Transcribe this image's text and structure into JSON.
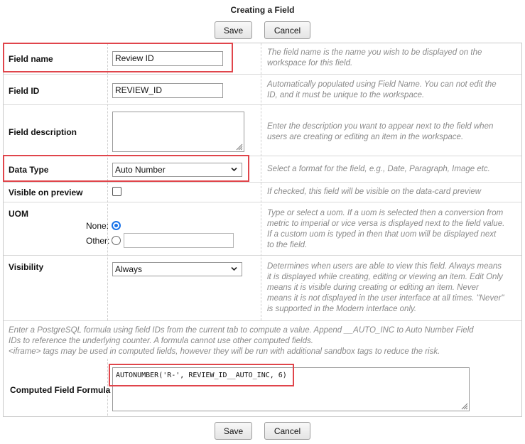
{
  "header": {
    "title": "Creating a Field"
  },
  "toolbar": {
    "save_label": "Save",
    "cancel_label": "Cancel"
  },
  "fields": {
    "field_name": {
      "label": "Field name",
      "value": "Review ID",
      "help": [
        "The field name is the name you wish to be displayed on the",
        "workspace for this field."
      ]
    },
    "field_id": {
      "label": "Field ID",
      "value": "REVIEW_ID",
      "help": [
        "Automatically populated using Field Name. You can not edit the",
        "ID, and it must be unique to the workspace."
      ]
    },
    "field_description": {
      "label": "Field description",
      "value": "",
      "help": [
        "Enter the description you want to appear next to the field when",
        "users are creating or editing an item in the workspace."
      ]
    },
    "data_type": {
      "label": "Data Type",
      "value": "Auto Number",
      "help": [
        "Select a format for the field, e.g., Date, Paragraph, Image etc."
      ]
    },
    "visible_on_preview": {
      "label": "Visible on preview",
      "checked": false,
      "help": [
        "If checked, this field will be visible on the data-card preview"
      ]
    },
    "uom": {
      "label": "UOM",
      "none_label": "None:",
      "other_label": "Other:",
      "selected": "None",
      "other_value": "",
      "help": [
        "Type or select a uom. If a uom is selected then a conversion from",
        "metric to imperial or vice versa is displayed next to the field value.",
        "If a custom uom is typed in then that uom will be displayed next",
        "to the field."
      ]
    },
    "visibility": {
      "label": "Visibility",
      "value": "Always",
      "help": [
        "Determines when users are able to view this field. Always means",
        "it is displayed while creating, editing or viewing an item. Edit Only",
        "means it is visible during creating or editing an item. Never",
        "means it is not displayed in the user interface at all times. \"Never\"",
        "is supported in the Modern interface only."
      ]
    },
    "computed": {
      "intro": [
        "Enter a PostgreSQL formula using field IDs from the current tab to compute a value. Append __AUTO_INC to Auto Number Field",
        "IDs to reference the underlying counter. A formula cannot use other computed fields.",
        "<iframe> tags may be used in computed fields, however they will be run with additional sandbox tags to reduce the risk."
      ],
      "label": "Computed Field Formula",
      "value": "AUTONUMBER('R-', REVIEW_ID__AUTO_INC, 6)"
    }
  },
  "colors": {
    "highlight": "#e0454b",
    "radio_selected": "#1a73e8",
    "help_text": "#8a8a8a"
  },
  "icons": {
    "dropdown": "chevron-down-icon",
    "resize": "resize-grip-icon"
  }
}
